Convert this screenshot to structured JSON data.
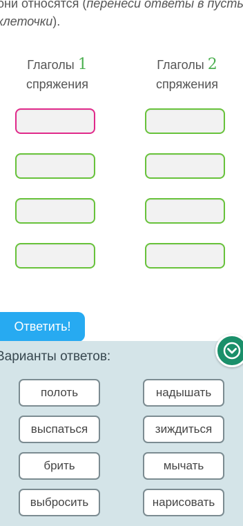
{
  "instruction": {
    "line1_prefix": "они относятся (",
    "line1_italic": "перенеси ответы в пустые",
    "line2_italic": "клеточки",
    "line2_suffix": ")."
  },
  "columns": [
    {
      "word": "Глаголы",
      "number": "1",
      "subtitle": "спряжения"
    },
    {
      "word": "Глаголы",
      "number": "2",
      "subtitle": "спряжения"
    }
  ],
  "answer_button": {
    "label": "Ответить!"
  },
  "variants": {
    "title": "Варианты ответов:",
    "items": [
      "полоть",
      "надышать",
      "выспаться",
      "зиждиться",
      "брить",
      "мычать",
      "выбросить",
      "нарисовать"
    ]
  },
  "colors": {
    "slot_border": "#67c23a",
    "slot_active_border": "#e0298a",
    "number_green": "#4caf50",
    "button_blue": "#27aaf1",
    "variants_bg": "#d4e4e8",
    "collapse_green": "#1a8f6a"
  },
  "icons": {
    "collapse": "chevron-down-icon"
  }
}
